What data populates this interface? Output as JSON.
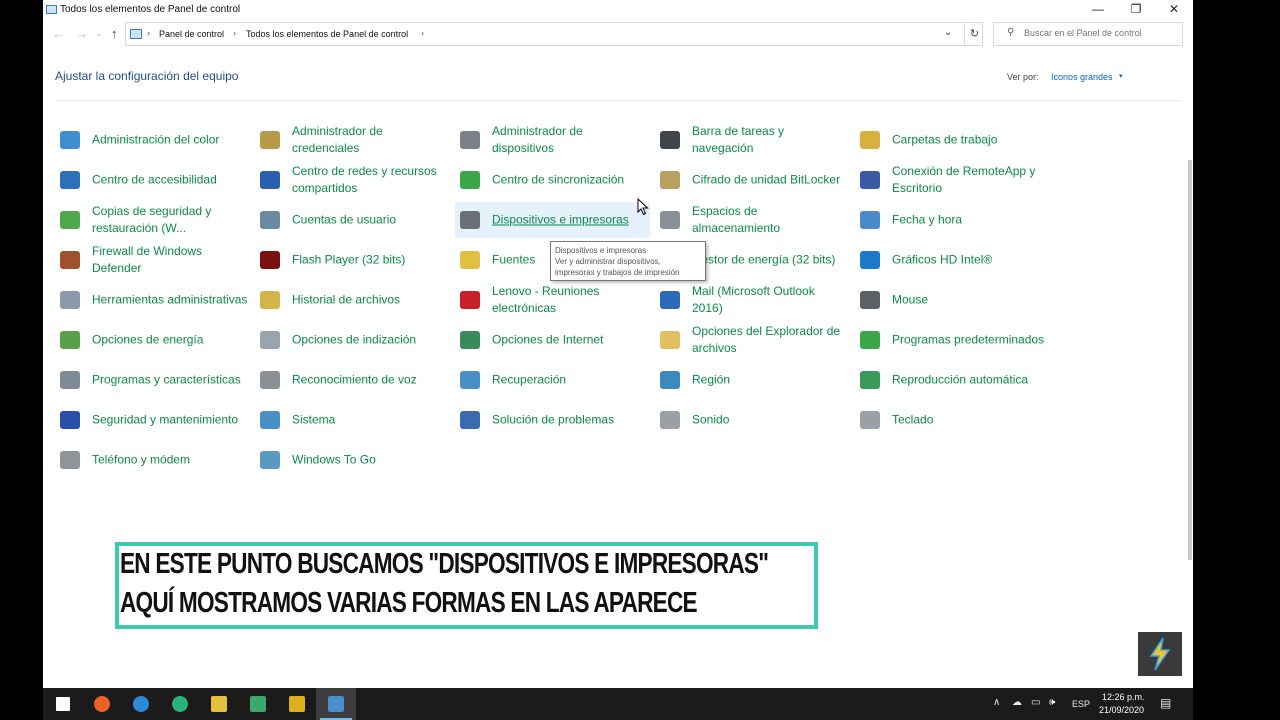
{
  "window": {
    "title": "Todos los elementos de Panel de control",
    "minimize_glyph": "—",
    "maximize_glyph": "❐",
    "close_glyph": "✕"
  },
  "nav": {
    "back_glyph": "←",
    "forward_glyph": "→",
    "dropdown_glyph": "⌄",
    "up_glyph": "↑",
    "refresh_glyph": "↻"
  },
  "address": {
    "breadcrumbs": [
      "Panel de control",
      "Todos los elementos de Panel de control"
    ],
    "separator": "›"
  },
  "search": {
    "placeholder": "Buscar en el Panel de control",
    "icon": "search-icon"
  },
  "page": {
    "heading": "Ajustar la configuración del equipo",
    "view_by_label": "Ver por:",
    "view_by_value": "Iconos grandes",
    "view_by_caret": "▾"
  },
  "items": [
    {
      "label": "Administración del color",
      "icon": "color-management-icon",
      "color": "#3f8fd0"
    },
    {
      "label": "Centro de accesibilidad",
      "icon": "accessibility-icon",
      "color": "#2d6fb8"
    },
    {
      "label": "Copias de seguridad y restauración (W...",
      "icon": "backup-icon",
      "color": "#4ea84a"
    },
    {
      "label": "Firewall de Windows Defender",
      "icon": "firewall-icon",
      "color": "#a0502a"
    },
    {
      "label": "Herramientas administrativas",
      "icon": "admin-tools-icon",
      "color": "#8a9aaa"
    },
    {
      "label": "Opciones de energía",
      "icon": "power-icon",
      "color": "#5aa04a"
    },
    {
      "label": "Programas y características",
      "icon": "programs-icon",
      "color": "#7d8a96"
    },
    {
      "label": "Seguridad y mantenimiento",
      "icon": "flag-icon",
      "color": "#2a4fa8"
    },
    {
      "label": "Teléfono y módem",
      "icon": "phone-icon",
      "color": "#8e969c"
    },
    {
      "label": "Administrador de credenciales",
      "icon": "credentials-icon",
      "color": "#b89a4a"
    },
    {
      "label": "Centro de redes y recursos compartidos",
      "icon": "network-icon",
      "color": "#2a5fb0"
    },
    {
      "label": "Cuentas de usuario",
      "icon": "users-icon",
      "color": "#6a8aa0"
    },
    {
      "label": "Flash Player (32 bits)",
      "icon": "flash-icon",
      "color": "#7a1010"
    },
    {
      "label": "Historial de archivos",
      "icon": "file-history-icon",
      "color": "#d4b54a"
    },
    {
      "label": "Opciones de indización",
      "icon": "indexing-icon",
      "color": "#9aa4ae"
    },
    {
      "label": "Reconocimiento de voz",
      "icon": "microphone-icon",
      "color": "#8a9096"
    },
    {
      "label": "Sistema",
      "icon": "system-icon",
      "color": "#4a90c8"
    },
    {
      "label": "Windows To Go",
      "icon": "windows-to-go-icon",
      "color": "#5a9ac0"
    },
    {
      "label": "Administrador de dispositivos",
      "icon": "device-manager-icon",
      "color": "#7a8088"
    },
    {
      "label": "Centro de sincronización",
      "icon": "sync-icon",
      "color": "#3aa84a"
    },
    {
      "label": "Dispositivos e impresoras",
      "icon": "printer-icon",
      "color": "#6a7078"
    },
    {
      "label": "Fuentes",
      "icon": "fonts-icon",
      "color": "#e0c040"
    },
    {
      "label": "Lenovo - Reuniones electrónicas",
      "icon": "lenovo-icon",
      "color": "#c8202a"
    },
    {
      "label": "Opciones de Internet",
      "icon": "internet-icon",
      "color": "#3a8a5a"
    },
    {
      "label": "Recuperación",
      "icon": "recovery-icon",
      "color": "#4a90c8"
    },
    {
      "label": "Solución de problemas",
      "icon": "troubleshoot-icon",
      "color": "#3a6ab0"
    },
    {
      "label": "Barra de tareas y navegación",
      "icon": "taskbar-icon",
      "color": "#40464c"
    },
    {
      "label": "Cifrado de unidad BitLocker",
      "icon": "bitlocker-icon",
      "color": "#b8a060"
    },
    {
      "label": "Espacios de almacenamiento",
      "icon": "storage-icon",
      "color": "#8a9098"
    },
    {
      "label": "Gestor de energía (32 bits)",
      "icon": "energy-manager-icon",
      "color": "#d05050"
    },
    {
      "label": "Mail (Microsoft Outlook 2016)",
      "icon": "mail-icon",
      "color": "#2a6ab8"
    },
    {
      "label": "Opciones del Explorador de archivos",
      "icon": "folder-options-icon",
      "color": "#e0c060"
    },
    {
      "label": "Región",
      "icon": "region-icon",
      "color": "#3a8ac0"
    },
    {
      "label": "Sonido",
      "icon": "sound-icon",
      "color": "#9aa0a6"
    },
    {
      "label": "Carpetas de trabajo",
      "icon": "work-folders-icon",
      "color": "#d8b040"
    },
    {
      "label": "Conexión de RemoteApp y Escritorio",
      "icon": "remoteapp-icon",
      "color": "#3a5aa8"
    },
    {
      "label": "Fecha y hora",
      "icon": "clock-icon",
      "color": "#4a8ac8"
    },
    {
      "label": "Gráficos HD Intel®",
      "icon": "intel-graphics-icon",
      "color": "#1a7ac8"
    },
    {
      "label": "Mouse",
      "icon": "mouse-icon",
      "color": "#5a6066"
    },
    {
      "label": "Programas predeterminados",
      "icon": "default-programs-icon",
      "color": "#3aa84a"
    },
    {
      "label": "Reproducción automática",
      "icon": "autoplay-icon",
      "color": "#3a9a5a"
    },
    {
      "label": "Teclado",
      "icon": "keyboard-icon",
      "color": "#9aa0a6"
    }
  ],
  "tooltip": {
    "title": "Dispositivos e impresoras",
    "description": "Ver y administrar dispositivos, impresoras y trabajos de impresión"
  },
  "caption": {
    "line1": "EN ESTE PUNTO BUSCAMOS \"DISPOSITIVOS E IMPRESORAS\"",
    "line2": "AQUÍ MOSTRAMOS VARIAS FORMAS EN LAS APARECE",
    "border_color": "#3ec7b3"
  },
  "watermark": {
    "icon": "lightning-icon",
    "glyph": "⚡"
  },
  "taskbar": {
    "apps": [
      {
        "name": "start-button",
        "icon": "windows-logo-icon",
        "color": "#ffffff"
      },
      {
        "name": "firefox",
        "icon": "firefox-icon",
        "color": "#e8622a"
      },
      {
        "name": "edge",
        "icon": "edge-icon",
        "color": "#2a8ad8"
      },
      {
        "name": "edge-dev",
        "icon": "edge-dev-icon",
        "color": "#2ab07a"
      },
      {
        "name": "file-explorer",
        "icon": "folder-icon",
        "color": "#e8c040"
      },
      {
        "name": "app",
        "icon": "app-icon",
        "color": "#3aa86a"
      },
      {
        "name": "chrome",
        "icon": "chrome-icon",
        "color": "#e0b020"
      },
      {
        "name": "control-panel",
        "icon": "control-panel-icon",
        "color": "#4a90d0"
      }
    ],
    "tray": {
      "chevron": "∧",
      "cloud": "☁",
      "network": "▭",
      "volume": "🕪",
      "language": "ESP",
      "time": "12:26 p.m.",
      "date": "21/09/2020",
      "notifications": "▤"
    }
  }
}
